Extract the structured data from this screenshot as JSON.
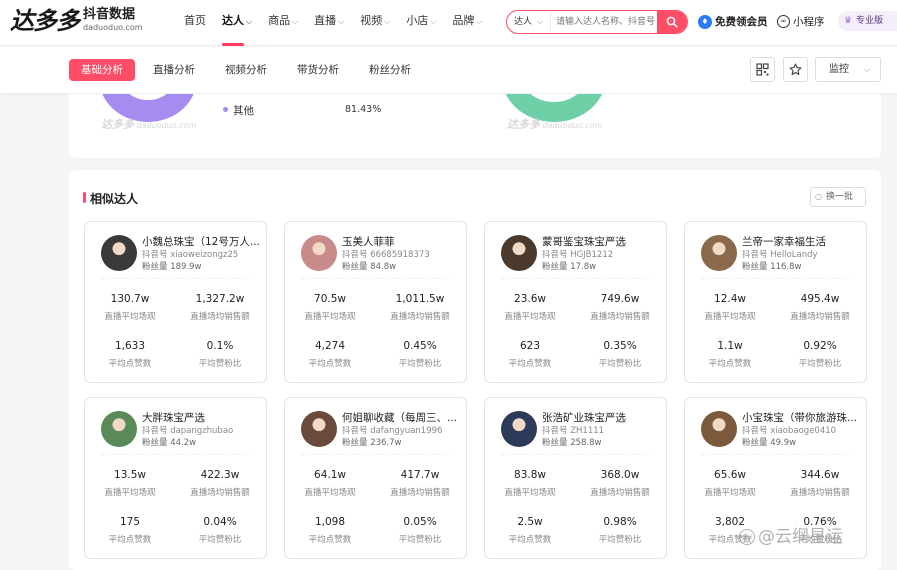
{
  "header": {
    "logo_main": "达多多",
    "logo_cn": "抖音数据",
    "logo_en": "daduoduo.com",
    "nav": [
      {
        "label": "首页",
        "caret": false,
        "active": false
      },
      {
        "label": "达人",
        "caret": true,
        "active": true
      },
      {
        "label": "商品",
        "caret": true,
        "active": false
      },
      {
        "label": "直播",
        "caret": true,
        "active": false
      },
      {
        "label": "视频",
        "caret": true,
        "active": false
      },
      {
        "label": "小店",
        "caret": true,
        "active": false
      },
      {
        "label": "品牌",
        "caret": true,
        "active": false
      }
    ],
    "search_type": "达人",
    "search_placeholder": "请输入达人名称、抖音号",
    "vip_label": "免费领会员",
    "mini_label": "小程序",
    "pro_label": "专业版"
  },
  "subnav": {
    "tabs": [
      {
        "label": "基础分析",
        "active": true
      },
      {
        "label": "直播分析",
        "active": false
      },
      {
        "label": "视频分析",
        "active": false
      },
      {
        "label": "带货分析",
        "active": false
      },
      {
        "label": "粉丝分析",
        "active": false
      }
    ],
    "monitor_label": "监控"
  },
  "chart_panel": {
    "legend_label": "其他",
    "legend_value": "81.43%",
    "watermark_cn": "达多多",
    "watermark_en": "daduoduo.com"
  },
  "similar": {
    "title": "相似达人",
    "swap_label": "换一批",
    "stat_labels": {
      "a": "直播平均场观",
      "b": "直播场均销售额",
      "c": "平均点赞数",
      "d": "平均赞粉比"
    },
    "cards": [
      {
        "name": "小魏总珠宝（12号万人...",
        "account": "抖音号 xiaoweizongz25",
        "fans": "粉丝量 189.9w",
        "v1": "130.7w",
        "v2": "1,327.2w",
        "v3": "1,633",
        "v4": "0.1%",
        "avatar_color": "#3a3a3a"
      },
      {
        "name": "玉美人菲菲",
        "account": "抖音号 66685918373",
        "fans": "粉丝量 84.8w",
        "v1": "70.5w",
        "v2": "1,011.5w",
        "v3": "4,274",
        "v4": "0.45%",
        "avatar_color": "#c98a8a"
      },
      {
        "name": "蒙哥鉴宝珠宝严选",
        "account": "抖音号 HGJB1212",
        "fans": "粉丝量 17.8w",
        "v1": "23.6w",
        "v2": "749.6w",
        "v3": "623",
        "v4": "0.35%",
        "avatar_color": "#4a3a2e"
      },
      {
        "name": "兰帝一家幸福生活",
        "account": "抖音号 HelloLandy",
        "fans": "粉丝量 116.8w",
        "v1": "12.4w",
        "v2": "495.4w",
        "v3": "1.1w",
        "v4": "0.92%",
        "avatar_color": "#8a6a4a"
      },
      {
        "name": "大胖珠宝严选",
        "account": "抖音号 dapangzhubao",
        "fans": "粉丝量 44.2w",
        "v1": "13.5w",
        "v2": "422.3w",
        "v3": "175",
        "v4": "0.04%",
        "avatar_color": "#5a8a5a"
      },
      {
        "name": "何姐聊收藏（每周三、...",
        "account": "抖音号 dafangyuan1996",
        "fans": "粉丝量 236.7w",
        "v1": "64.1w",
        "v2": "417.7w",
        "v3": "1,098",
        "v4": "0.05%",
        "avatar_color": "#6a4a3a"
      },
      {
        "name": "张浩矿业珠宝严选",
        "account": "抖音号 ZH1111",
        "fans": "粉丝量 258.8w",
        "v1": "83.8w",
        "v2": "368.0w",
        "v3": "2.5w",
        "v4": "0.98%",
        "avatar_color": "#2e3a5a"
      },
      {
        "name": "小宝珠宝（带你旅游珠...",
        "account": "抖音号 xiaobaoge0410",
        "fans": "粉丝量 49.9w",
        "v1": "65.6w",
        "v2": "344.6w",
        "v3": "3,802",
        "v4": "0.76%",
        "avatar_color": "#7a5a3a"
      }
    ]
  },
  "overlay_watermark": "@云纲星运"
}
